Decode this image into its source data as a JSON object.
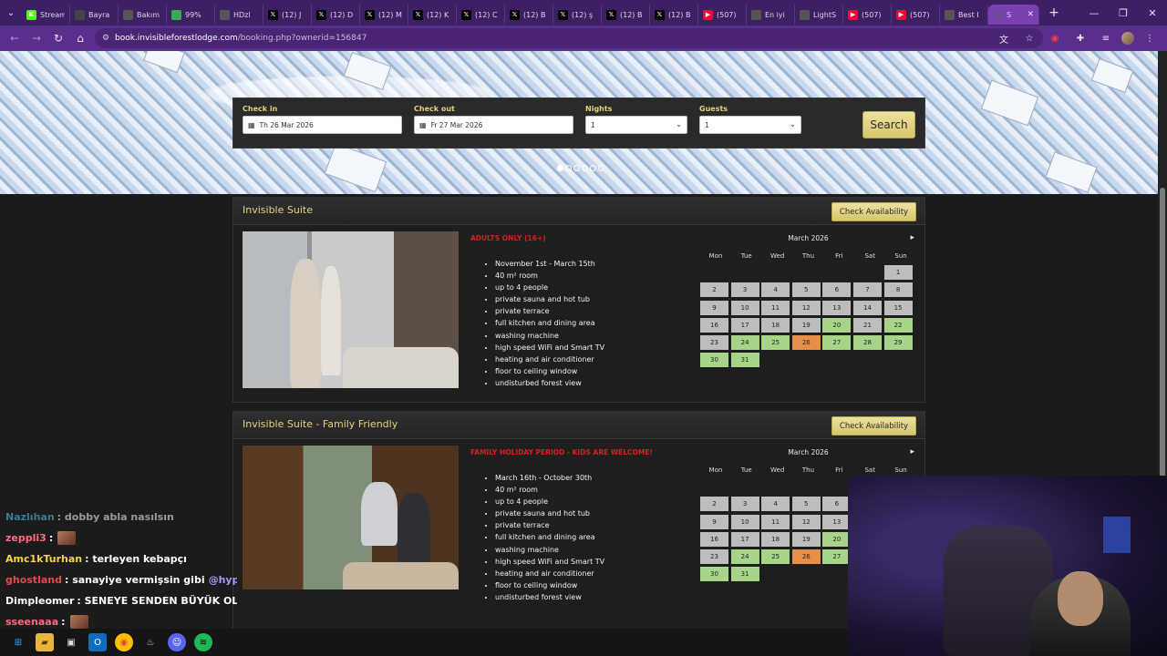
{
  "browser": {
    "tabs": [
      {
        "label": "Stream",
        "icon": "kick-icon",
        "color": "#53fc18"
      },
      {
        "label": "Bayra",
        "icon": "page-icon",
        "color": "#444444"
      },
      {
        "label": "Bakım",
        "icon": "globe-icon",
        "color": "#555555"
      },
      {
        "label": "99%",
        "icon": "grammar-icon",
        "color": "#3aa757"
      },
      {
        "label": "HDzl",
        "icon": "globe-icon",
        "color": "#555555"
      },
      {
        "label": "(12) J",
        "icon": "x-icon",
        "color": "#000000"
      },
      {
        "label": "(12) D",
        "icon": "x-icon",
        "color": "#000000"
      },
      {
        "label": "(12) M",
        "icon": "x-icon",
        "color": "#000000"
      },
      {
        "label": "(12) K",
        "icon": "x-icon",
        "color": "#000000"
      },
      {
        "label": "(12) C",
        "icon": "x-icon",
        "color": "#000000"
      },
      {
        "label": "(12) B",
        "icon": "x-icon",
        "color": "#000000"
      },
      {
        "label": "(12) ş",
        "icon": "x-icon",
        "color": "#000000"
      },
      {
        "label": "(12) B",
        "icon": "x-icon",
        "color": "#000000"
      },
      {
        "label": "(12) B",
        "icon": "x-icon",
        "color": "#000000"
      },
      {
        "label": "(507)",
        "icon": "youtube-icon",
        "color": "#ff0033"
      },
      {
        "label": "En iyi",
        "icon": "globe-icon",
        "color": "#555555"
      },
      {
        "label": "LightS",
        "icon": "feather-icon",
        "color": "#555555"
      },
      {
        "label": "(507)",
        "icon": "youtube-icon",
        "color": "#ff0033"
      },
      {
        "label": "(507)",
        "icon": "youtube-icon",
        "color": "#ff0033"
      },
      {
        "label": "Best I",
        "icon": "globe-icon",
        "color": "#555555"
      },
      {
        "label": "S",
        "icon": "site-icon",
        "color": "#6d4a9c",
        "active": true
      }
    ],
    "new_tab": "+",
    "url_host": "book.invisibleforestlodge.com",
    "url_path": "/booking.php?ownerid=156847"
  },
  "search": {
    "checkin_label": "Check in",
    "checkin_value": "Th 26 Mar 2026",
    "checkout_label": "Check out",
    "checkout_value": "Fr 27 Mar 2026",
    "nights_label": "Nights",
    "nights_value": "1",
    "guests_label": "Guests",
    "guests_value": "1",
    "button": "Search"
  },
  "suites": [
    {
      "title": "Invisible Suite",
      "button": "Check Availability",
      "tagline": "ADULTS ONLY (16+)",
      "features": [
        "November 1st - March 15th",
        "40 m² room",
        "up to 4 people",
        "private sauna and hot tub",
        "private terrace",
        "full kitchen and dining area",
        "washing machine",
        "high speed WiFi and Smart TV",
        "heating and air conditioner",
        "floor to ceiling window",
        "undisturbed forest view"
      ],
      "calendar": {
        "month": "March 2026",
        "next": "▸",
        "dows": [
          "Mon",
          "Tue",
          "Wed",
          "Thu",
          "Fri",
          "Sat",
          "Sun"
        ],
        "days": [
          {
            "d": "",
            "s": "empty"
          },
          {
            "d": "",
            "s": "empty"
          },
          {
            "d": "",
            "s": "empty"
          },
          {
            "d": "",
            "s": "empty"
          },
          {
            "d": "",
            "s": "empty"
          },
          {
            "d": "",
            "s": "empty"
          },
          {
            "d": "1",
            "s": "na"
          },
          {
            "d": "2",
            "s": "na"
          },
          {
            "d": "3",
            "s": "na"
          },
          {
            "d": "4",
            "s": "na"
          },
          {
            "d": "5",
            "s": "na"
          },
          {
            "d": "6",
            "s": "na"
          },
          {
            "d": "7",
            "s": "na"
          },
          {
            "d": "8",
            "s": "na"
          },
          {
            "d": "9",
            "s": "na"
          },
          {
            "d": "10",
            "s": "na"
          },
          {
            "d": "11",
            "s": "na"
          },
          {
            "d": "12",
            "s": "na"
          },
          {
            "d": "13",
            "s": "na"
          },
          {
            "d": "14",
            "s": "na"
          },
          {
            "d": "15",
            "s": "na"
          },
          {
            "d": "16",
            "s": "na"
          },
          {
            "d": "17",
            "s": "na"
          },
          {
            "d": "18",
            "s": "na"
          },
          {
            "d": "19",
            "s": "na"
          },
          {
            "d": "20",
            "s": "av"
          },
          {
            "d": "21",
            "s": "na"
          },
          {
            "d": "22",
            "s": "av"
          },
          {
            "d": "23",
            "s": "na"
          },
          {
            "d": "24",
            "s": "av"
          },
          {
            "d": "25",
            "s": "av"
          },
          {
            "d": "26",
            "s": "sel"
          },
          {
            "d": "27",
            "s": "av"
          },
          {
            "d": "28",
            "s": "av"
          },
          {
            "d": "29",
            "s": "av"
          },
          {
            "d": "30",
            "s": "av"
          },
          {
            "d": "31",
            "s": "av"
          }
        ]
      }
    },
    {
      "title": "Invisible Suite - Family Friendly",
      "button": "Check Availability",
      "tagline": "FAMILY HOLIDAY PERIOD - KIDS ARE WELCOME!",
      "features": [
        "March 16th - October 30th",
        "40 m² room",
        "up to 4 people",
        "private sauna and hot tub",
        "private terrace",
        "full kitchen and dining area",
        "washing machine",
        "high speed WiFi and Smart TV",
        "heating and air conditioner",
        "floor to ceiling window",
        "undisturbed forest view"
      ],
      "calendar": {
        "month": "March 2026",
        "next": "▸",
        "dows": [
          "Mon",
          "Tue",
          "Wed",
          "Thu",
          "Fri",
          "Sat",
          "Sun"
        ],
        "days": [
          {
            "d": "",
            "s": "empty"
          },
          {
            "d": "",
            "s": "empty"
          },
          {
            "d": "",
            "s": "empty"
          },
          {
            "d": "",
            "s": "empty"
          },
          {
            "d": "",
            "s": "empty"
          },
          {
            "d": "",
            "s": "empty"
          },
          {
            "d": "",
            "s": "empty"
          },
          {
            "d": "2",
            "s": "na"
          },
          {
            "d": "3",
            "s": "na"
          },
          {
            "d": "4",
            "s": "na"
          },
          {
            "d": "5",
            "s": "na"
          },
          {
            "d": "6",
            "s": "na"
          },
          {
            "d": "",
            "s": "empty"
          },
          {
            "d": "",
            "s": "empty"
          },
          {
            "d": "9",
            "s": "na"
          },
          {
            "d": "10",
            "s": "na"
          },
          {
            "d": "11",
            "s": "na"
          },
          {
            "d": "12",
            "s": "na"
          },
          {
            "d": "13",
            "s": "na"
          },
          {
            "d": "",
            "s": "empty"
          },
          {
            "d": "",
            "s": "empty"
          },
          {
            "d": "16",
            "s": "na"
          },
          {
            "d": "17",
            "s": "na"
          },
          {
            "d": "18",
            "s": "na"
          },
          {
            "d": "19",
            "s": "na"
          },
          {
            "d": "20",
            "s": "av"
          },
          {
            "d": "",
            "s": "empty"
          },
          {
            "d": "",
            "s": "empty"
          },
          {
            "d": "23",
            "s": "na"
          },
          {
            "d": "24",
            "s": "av"
          },
          {
            "d": "25",
            "s": "av"
          },
          {
            "d": "26",
            "s": "sel"
          },
          {
            "d": "27",
            "s": "av"
          },
          {
            "d": "",
            "s": "empty"
          },
          {
            "d": "",
            "s": "empty"
          },
          {
            "d": "30",
            "s": "av"
          },
          {
            "d": "31",
            "s": "av"
          }
        ]
      }
    }
  ],
  "chat": [
    {
      "user": "Nazlıhan",
      "user_color": "#56c6f5",
      "msg": ": dobby abla nasılsın",
      "emote": false
    },
    {
      "user": "zeppli3",
      "user_color": "#ff6b81",
      "msg": ":",
      "emote": true
    },
    {
      "user": "Amc1kTurhan",
      "user_color": "#f5d442",
      "msg": ": terleyen kebapçı",
      "emote": false
    },
    {
      "user": "ghostland",
      "user_color": "#e5484d",
      "msg": ": sanayiye vermişsin gibi",
      "mention": "@hype",
      "emote": false
    },
    {
      "user": "Dimpleomer",
      "user_color": "#ffffff",
      "msg": ": SENEYE SENDEN BÜYÜK OLACAK ÇAĞRI",
      "emote": false
    },
    {
      "user": "sseenaaa",
      "user_color": "#ff6b81",
      "msg": ":",
      "emote": true
    }
  ],
  "colors": {
    "accent_gold": "#e4d27b",
    "tagline_red": "#d81f1f",
    "available": "#a8d48a",
    "unavailable": "#bdbdbd",
    "selected": "#e58f4a"
  }
}
